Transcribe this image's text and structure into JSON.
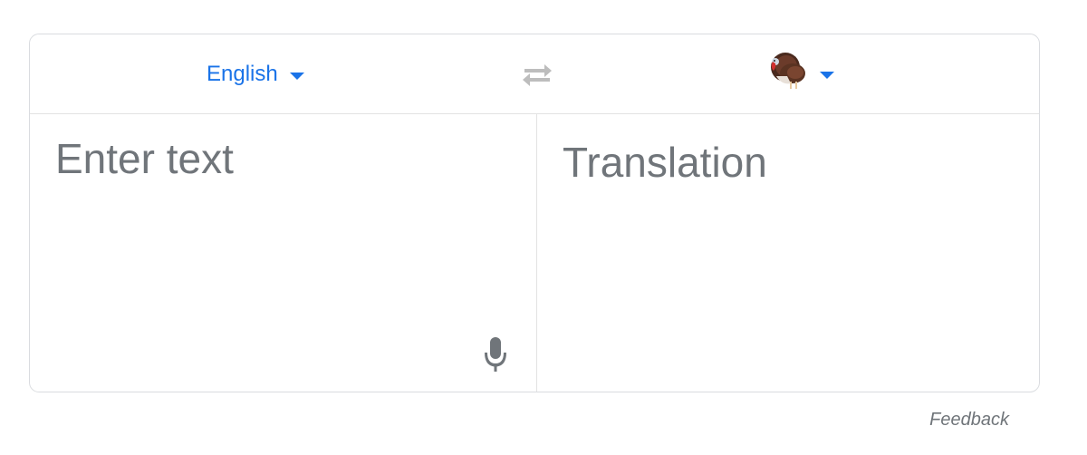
{
  "translator": {
    "source_language": "English",
    "target_language_icon": "turkey-emoji",
    "swap_icon": "swap-arrows-icon",
    "source_placeholder": "Enter text",
    "translation_placeholder": "Translation",
    "mic_icon": "microphone-icon",
    "feedback_label": "Feedback"
  },
  "colors": {
    "accent": "#1a73e8",
    "placeholder": "#70757a",
    "border": "#dadce0",
    "swap_disabled": "#bdbdbd"
  }
}
